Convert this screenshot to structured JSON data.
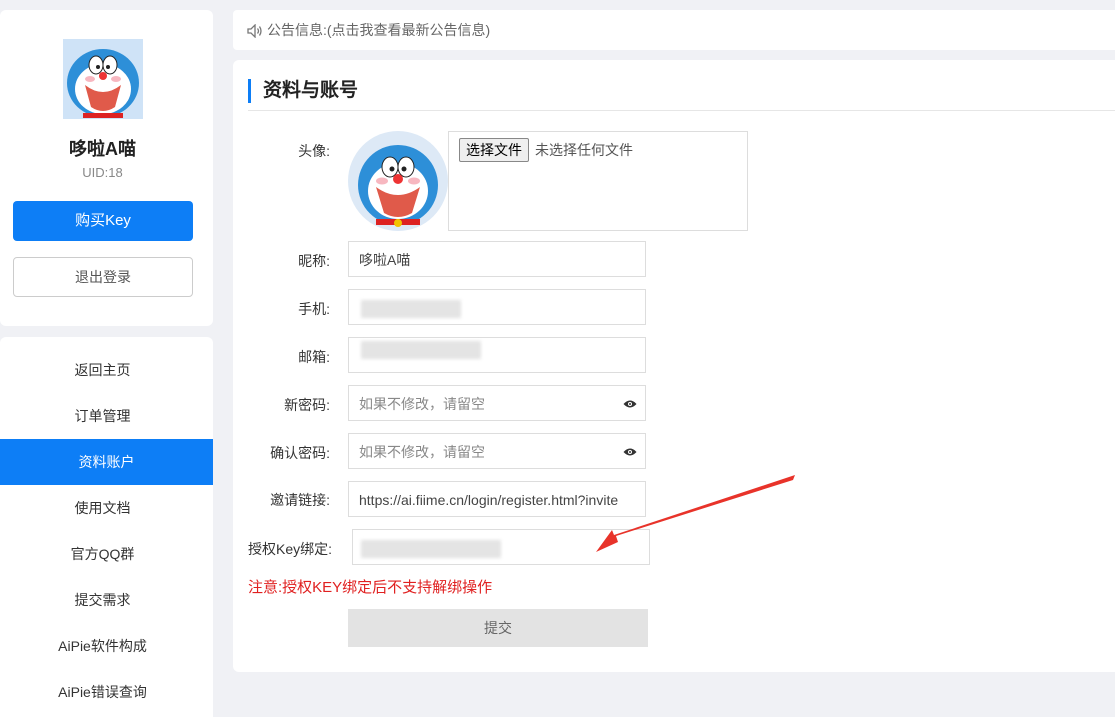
{
  "notice": {
    "text": "公告信息:(点击我查看最新公告信息)",
    "icon": "speaker-icon"
  },
  "profile": {
    "name": "哆啦A喵",
    "uid": "UID:18",
    "buy_key_label": "购买Key",
    "logout_label": "退出登录"
  },
  "nav": {
    "items": [
      {
        "label": "返回主页"
      },
      {
        "label": "订单管理"
      },
      {
        "label": "资料账户",
        "active": true
      },
      {
        "label": "使用文档"
      },
      {
        "label": "官方QQ群"
      },
      {
        "label": "提交需求"
      },
      {
        "label": "AiPie软件构成"
      },
      {
        "label": "AiPie错误查询"
      }
    ]
  },
  "form": {
    "title": "资料与账号",
    "avatar_label": "头像:",
    "file_button": "选择文件",
    "file_status": "未选择任何文件",
    "nickname_label": "昵称:",
    "nickname_value": "哆啦A喵",
    "phone_label": "手机:",
    "email_label": "邮箱:",
    "new_password_label": "新密码:",
    "new_password_placeholder": "如果不修改，请留空",
    "confirm_password_label": "确认密码:",
    "confirm_password_placeholder": "如果不修改，请留空",
    "invite_label": "邀请链接:",
    "invite_value": "https://ai.fiime.cn/login/register.html?invite",
    "license_key_label": "授权Key绑定:",
    "warning": "注意:授权KEY绑定后不支持解绑操作",
    "submit_label": "提交"
  },
  "colors": {
    "accent": "#0d7ef6",
    "warning": "#e02020",
    "arrow": "#e8332a"
  }
}
